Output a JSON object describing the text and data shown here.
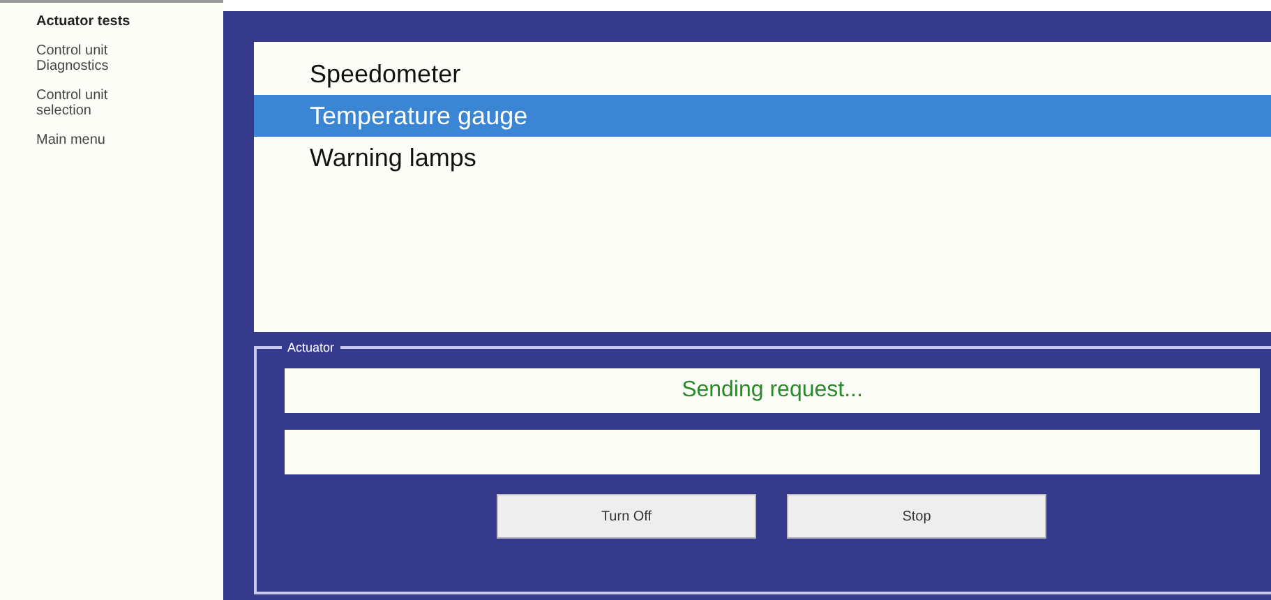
{
  "sidebar": {
    "items": [
      {
        "label": "Actuator tests",
        "selected": true
      },
      {
        "label": "Control unit Diagnostics",
        "selected": false
      },
      {
        "label": "Control unit selection",
        "selected": false
      },
      {
        "label": "Main menu",
        "selected": false
      }
    ]
  },
  "list": {
    "items": [
      {
        "label": "Speedometer",
        "selected": false
      },
      {
        "label": "Temperature gauge",
        "selected": true
      },
      {
        "label": "Warning lamps",
        "selected": false
      }
    ]
  },
  "actuator": {
    "title": "Actuator",
    "status": "Sending request...",
    "buttons": [
      "Turn Off",
      "Stop"
    ]
  }
}
